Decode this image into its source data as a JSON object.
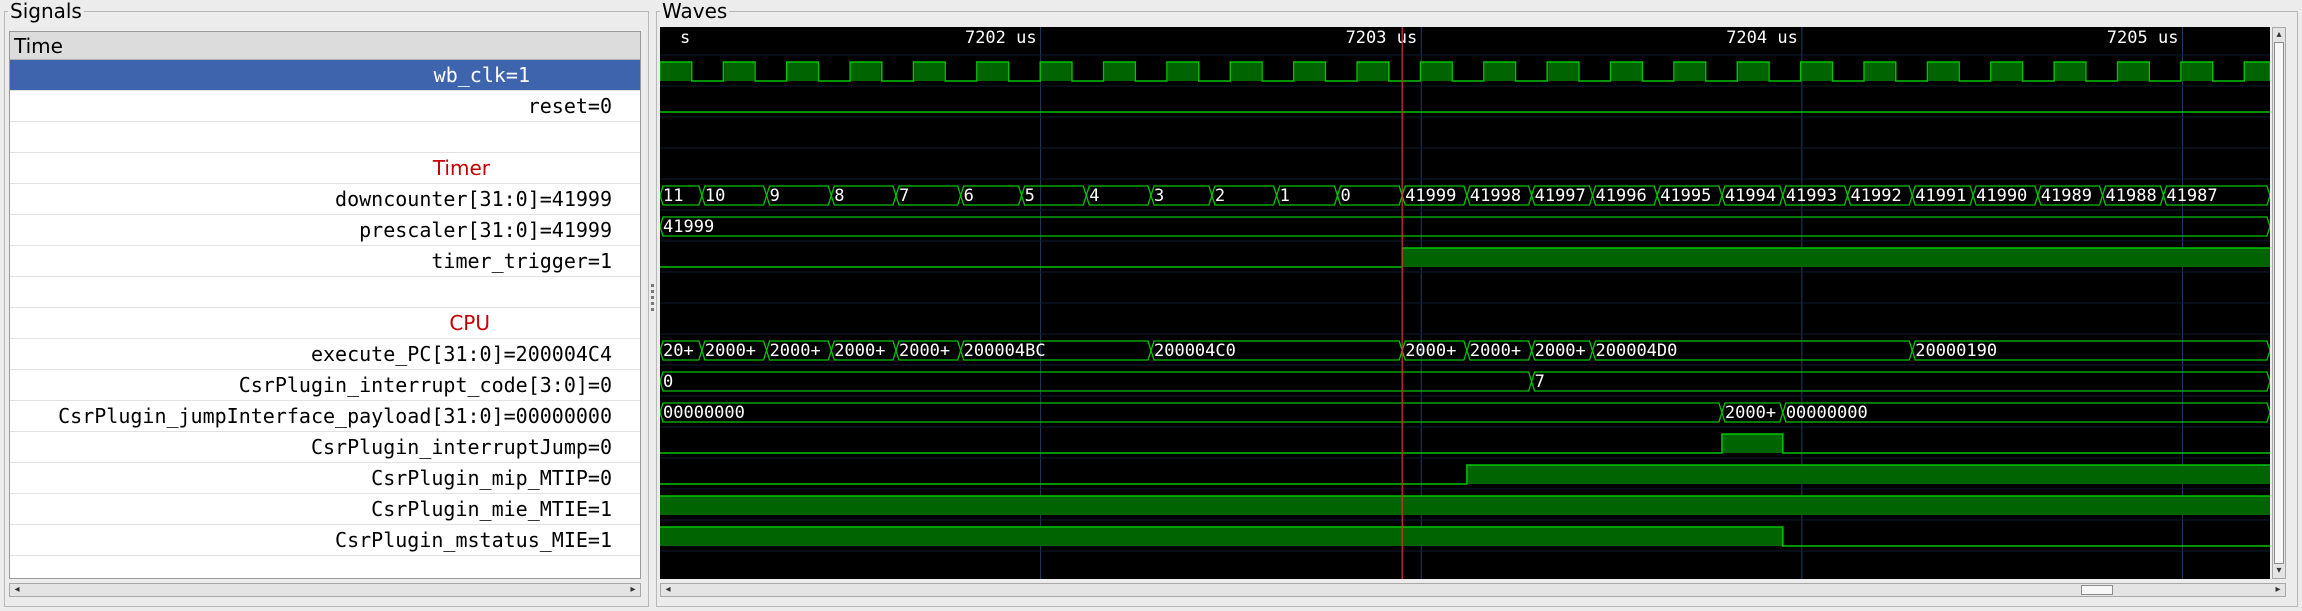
{
  "panels": {
    "signals_title": "Signals",
    "waves_title": "Waves"
  },
  "signals": {
    "header": "Time",
    "rows": [
      {
        "label": "wb_clk=1",
        "kind": "selected"
      },
      {
        "label": "reset=0",
        "kind": "signal"
      },
      {
        "label": "",
        "kind": "blank"
      },
      {
        "label": "Timer",
        "kind": "group"
      },
      {
        "label": "downcounter[31:0]=41999",
        "kind": "signal"
      },
      {
        "label": "prescaler[31:0]=41999",
        "kind": "signal"
      },
      {
        "label": "timer_trigger=1",
        "kind": "signal"
      },
      {
        "label": "",
        "kind": "blank"
      },
      {
        "label": "CPU",
        "kind": "group"
      },
      {
        "label": "execute_PC[31:0]=200004C4",
        "kind": "signal"
      },
      {
        "label": "CsrPlugin_interrupt_code[3:0]=0",
        "kind": "signal"
      },
      {
        "label": "CsrPlugin_jumpInterface_payload[31:0]=00000000",
        "kind": "signal"
      },
      {
        "label": "CsrPlugin_interruptJump=0",
        "kind": "signal"
      },
      {
        "label": "CsrPlugin_mip_MTIP=0",
        "kind": "signal"
      },
      {
        "label": "CsrPlugin_mie_MTIE=1",
        "kind": "signal"
      },
      {
        "label": "CsrPlugin_mstatus_MIE=1",
        "kind": "signal"
      }
    ]
  },
  "waves": {
    "time_labels": [
      {
        "text": "s",
        "t": 7201.09
      },
      {
        "text": "7202 us",
        "t": 7202
      },
      {
        "text": "7203 us",
        "t": 7203
      },
      {
        "text": "7204 us",
        "t": 7204
      },
      {
        "text": "7205 us",
        "t": 7205
      }
    ],
    "view_start": 7201.0,
    "view_end": 7205.23,
    "marker_t": 7202.95,
    "clock": {
      "start": 7201.0,
      "period": 0.1665,
      "duty": 0.5
    },
    "colors": {
      "wave": "#00c400",
      "fill": "#006400",
      "grid": "#233a63",
      "marker": "#c83232",
      "text": "#ffffff",
      "row_line": "#1e5f1e"
    },
    "rows": [
      {
        "row": 0,
        "type": "clock"
      },
      {
        "row": 1,
        "type": "bit",
        "segments": [
          {
            "t0": 7201.0,
            "t1": 7205.23,
            "v": 0
          }
        ]
      },
      {
        "row": 4,
        "type": "bus",
        "segments": [
          {
            "t0": 7201.0,
            "t1": 7201.11,
            "v": "11"
          },
          {
            "t0": 7201.11,
            "t1": 7201.28,
            "v": "10"
          },
          {
            "t0": 7201.28,
            "t1": 7201.45,
            "v": "9"
          },
          {
            "t0": 7201.45,
            "t1": 7201.62,
            "v": "8"
          },
          {
            "t0": 7201.62,
            "t1": 7201.79,
            "v": "7"
          },
          {
            "t0": 7201.79,
            "t1": 7201.95,
            "v": "6"
          },
          {
            "t0": 7201.95,
            "t1": 7202.12,
            "v": "5"
          },
          {
            "t0": 7202.12,
            "t1": 7202.29,
            "v": "4"
          },
          {
            "t0": 7202.29,
            "t1": 7202.45,
            "v": "3"
          },
          {
            "t0": 7202.45,
            "t1": 7202.62,
            "v": "2"
          },
          {
            "t0": 7202.62,
            "t1": 7202.78,
            "v": "1"
          },
          {
            "t0": 7202.78,
            "t1": 7202.95,
            "v": "0"
          },
          {
            "t0": 7202.95,
            "t1": 7203.12,
            "v": "41999"
          },
          {
            "t0": 7203.12,
            "t1": 7203.29,
            "v": "41998"
          },
          {
            "t0": 7203.29,
            "t1": 7203.45,
            "v": "41997"
          },
          {
            "t0": 7203.45,
            "t1": 7203.62,
            "v": "41996"
          },
          {
            "t0": 7203.62,
            "t1": 7203.79,
            "v": "41995"
          },
          {
            "t0": 7203.79,
            "t1": 7203.95,
            "v": "41994"
          },
          {
            "t0": 7203.95,
            "t1": 7204.12,
            "v": "41993"
          },
          {
            "t0": 7204.12,
            "t1": 7204.29,
            "v": "41992"
          },
          {
            "t0": 7204.29,
            "t1": 7204.45,
            "v": "41991"
          },
          {
            "t0": 7204.45,
            "t1": 7204.62,
            "v": "41990"
          },
          {
            "t0": 7204.62,
            "t1": 7204.79,
            "v": "41989"
          },
          {
            "t0": 7204.79,
            "t1": 7204.95,
            "v": "41988"
          },
          {
            "t0": 7204.95,
            "t1": 7205.23,
            "v": "41987"
          }
        ]
      },
      {
        "row": 5,
        "type": "bus",
        "segments": [
          {
            "t0": 7201.0,
            "t1": 7205.23,
            "v": "41999"
          }
        ]
      },
      {
        "row": 6,
        "type": "bit",
        "segments": [
          {
            "t0": 7201.0,
            "t1": 7202.95,
            "v": 0
          },
          {
            "t0": 7202.95,
            "t1": 7205.23,
            "v": 1
          }
        ]
      },
      {
        "row": 9,
        "type": "bus",
        "segments": [
          {
            "t0": 7201.0,
            "t1": 7201.11,
            "v": "20+"
          },
          {
            "t0": 7201.11,
            "t1": 7201.28,
            "v": "2000+"
          },
          {
            "t0": 7201.28,
            "t1": 7201.45,
            "v": "2000+"
          },
          {
            "t0": 7201.45,
            "t1": 7201.62,
            "v": "2000+"
          },
          {
            "t0": 7201.62,
            "t1": 7201.79,
            "v": "2000+"
          },
          {
            "t0": 7201.79,
            "t1": 7202.29,
            "v": "200004BC"
          },
          {
            "t0": 7202.29,
            "t1": 7202.95,
            "v": "200004C0"
          },
          {
            "t0": 7202.95,
            "t1": 7203.12,
            "v": "2000+"
          },
          {
            "t0": 7203.12,
            "t1": 7203.29,
            "v": "2000+"
          },
          {
            "t0": 7203.29,
            "t1": 7203.45,
            "v": "2000+"
          },
          {
            "t0": 7203.45,
            "t1": 7204.29,
            "v": "200004D0"
          },
          {
            "t0": 7204.29,
            "t1": 7205.23,
            "v": "20000190"
          }
        ]
      },
      {
        "row": 10,
        "type": "bus",
        "segments": [
          {
            "t0": 7201.0,
            "t1": 7203.29,
            "v": "0"
          },
          {
            "t0": 7203.29,
            "t1": 7205.23,
            "v": "7"
          }
        ]
      },
      {
        "row": 11,
        "type": "bus",
        "segments": [
          {
            "t0": 7201.0,
            "t1": 7203.79,
            "v": "00000000"
          },
          {
            "t0": 7203.79,
            "t1": 7203.95,
            "v": "2000+"
          },
          {
            "t0": 7203.95,
            "t1": 7205.23,
            "v": "00000000"
          }
        ]
      },
      {
        "row": 12,
        "type": "bit",
        "segments": [
          {
            "t0": 7201.0,
            "t1": 7203.79,
            "v": 0
          },
          {
            "t0": 7203.79,
            "t1": 7203.95,
            "v": 1
          },
          {
            "t0": 7203.95,
            "t1": 7205.23,
            "v": 0
          }
        ]
      },
      {
        "row": 13,
        "type": "bit",
        "segments": [
          {
            "t0": 7201.0,
            "t1": 7203.12,
            "v": 0
          },
          {
            "t0": 7203.12,
            "t1": 7205.23,
            "v": 1
          }
        ]
      },
      {
        "row": 14,
        "type": "bit",
        "segments": [
          {
            "t0": 7201.0,
            "t1": 7205.23,
            "v": 1
          }
        ]
      },
      {
        "row": 15,
        "type": "bit",
        "segments": [
          {
            "t0": 7201.0,
            "t1": 7203.95,
            "v": 1
          },
          {
            "t0": 7203.95,
            "t1": 7205.23,
            "v": 0
          }
        ]
      }
    ]
  },
  "scrollbars": {
    "signals_h": {
      "left_arrow": "◂",
      "right_arrow": "▸"
    },
    "waves_h": {
      "left_arrow": "◂",
      "right_arrow": "▸",
      "position": 0.88,
      "visible_fraction": 0.02
    },
    "waves_v": {
      "up_arrow": "▴",
      "down_arrow": "▾"
    }
  }
}
